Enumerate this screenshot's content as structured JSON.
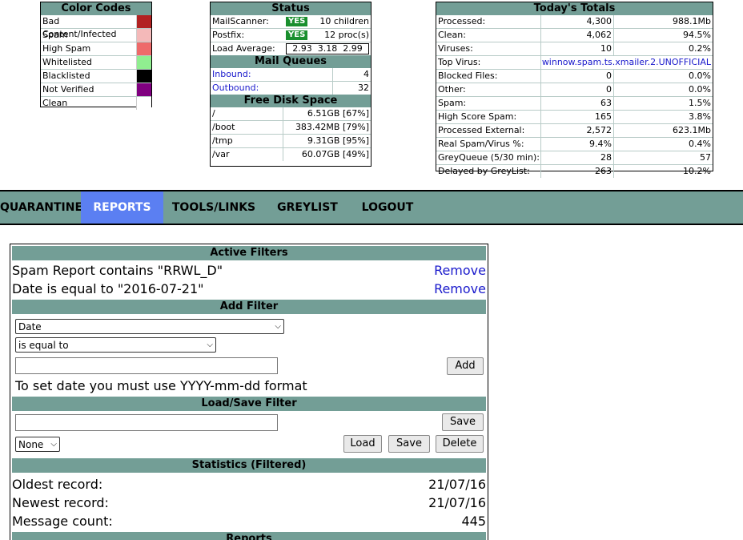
{
  "color_codes": {
    "title": "Color Codes",
    "items": [
      {
        "label": "Bad Content/Infected",
        "color": "#b22222"
      },
      {
        "label": "Spam",
        "color": "#f4b9b9"
      },
      {
        "label": "High Spam",
        "color": "#ee6a6a"
      },
      {
        "label": "Whitelisted",
        "color": "#90ee90"
      },
      {
        "label": "Blacklisted",
        "color": "#000000"
      },
      {
        "label": "Not Verified",
        "color": "#800080"
      },
      {
        "label": "Clean",
        "color": "#ffffff"
      }
    ]
  },
  "status": {
    "title": "Status",
    "mailscanner_label": "MailScanner:",
    "mailscanner_state": "YES",
    "mailscanner_detail": "10 children",
    "postfix_label": "Postfix:",
    "postfix_state": "YES",
    "postfix_detail": "12 proc(s)",
    "load_label": "Load Average:",
    "load_values": "2.93  3.18  2.99",
    "queues_title": "Mail Queues",
    "inbound_label": "Inbound:",
    "inbound_value": "4",
    "outbound_label": "Outbound:",
    "outbound_value": "32",
    "disk_title": "Free Disk Space",
    "disks": [
      {
        "mount": "/",
        "free": "6.51GB [67%]"
      },
      {
        "mount": "/boot",
        "free": "383.42MB [79%]"
      },
      {
        "mount": "/tmp",
        "free": "9.31GB [95%]"
      },
      {
        "mount": "/var",
        "free": "60.07GB [49%]"
      }
    ]
  },
  "totals": {
    "title": "Today's Totals",
    "rows": [
      {
        "label": "Processed:",
        "count": "4,300",
        "extra": "988.1Mb"
      },
      {
        "label": "Clean:",
        "count": "4,062",
        "extra": "94.5%"
      },
      {
        "label": "Viruses:",
        "count": "10",
        "extra": "0.2%"
      },
      {
        "label": "Top Virus:",
        "count": "",
        "extra": "winnow.spam.ts.xmailer.2.UNOFFICIAL"
      },
      {
        "label": "Blocked Files:",
        "count": "0",
        "extra": "0.0%"
      },
      {
        "label": "Other:",
        "count": "0",
        "extra": "0.0%"
      },
      {
        "label": "Spam:",
        "count": "63",
        "extra": "1.5%"
      },
      {
        "label": "High Score Spam:",
        "count": "165",
        "extra": "3.8%"
      },
      {
        "label": "Processed External:",
        "count": "2,572",
        "extra": "623.1Mb"
      },
      {
        "label": "Real Spam/Virus %:",
        "count": "9.4%",
        "extra": "0.4%"
      },
      {
        "label": "GreyQueue (5/30 min):",
        "count": "28",
        "extra": "57"
      },
      {
        "label": "Delayed by GreyList:",
        "count": "263",
        "extra": "10.2%"
      }
    ]
  },
  "nav": {
    "items": [
      "QUARANTINE",
      "REPORTS",
      "TOOLS/LINKS",
      "GREYLIST",
      "LOGOUT"
    ],
    "active": "REPORTS"
  },
  "filters": {
    "active_title": "Active Filters",
    "active": [
      {
        "text": "Spam Report contains \"RRWL_D\"",
        "remove": "Remove"
      },
      {
        "text": "Date is equal to \"2016-07-21\"",
        "remove": "Remove"
      }
    ],
    "add_title": "Add Filter",
    "field_select": "Date",
    "operator_select": "is equal to",
    "add_button": "Add",
    "date_hint": "To set date you must use YYYY-mm-dd format",
    "loadsave_title": "Load/Save Filter",
    "save_button_top": "Save",
    "saved_select": "None",
    "load_button": "Load",
    "save_button": "Save",
    "delete_button": "Delete",
    "stats_title": "Statistics (Filtered)",
    "oldest_label": "Oldest record:",
    "oldest_value": "21/07/16",
    "newest_label": "Newest record:",
    "newest_value": "21/07/16",
    "count_label": "Message count:",
    "count_value": "445",
    "reports_title": "Reports"
  }
}
